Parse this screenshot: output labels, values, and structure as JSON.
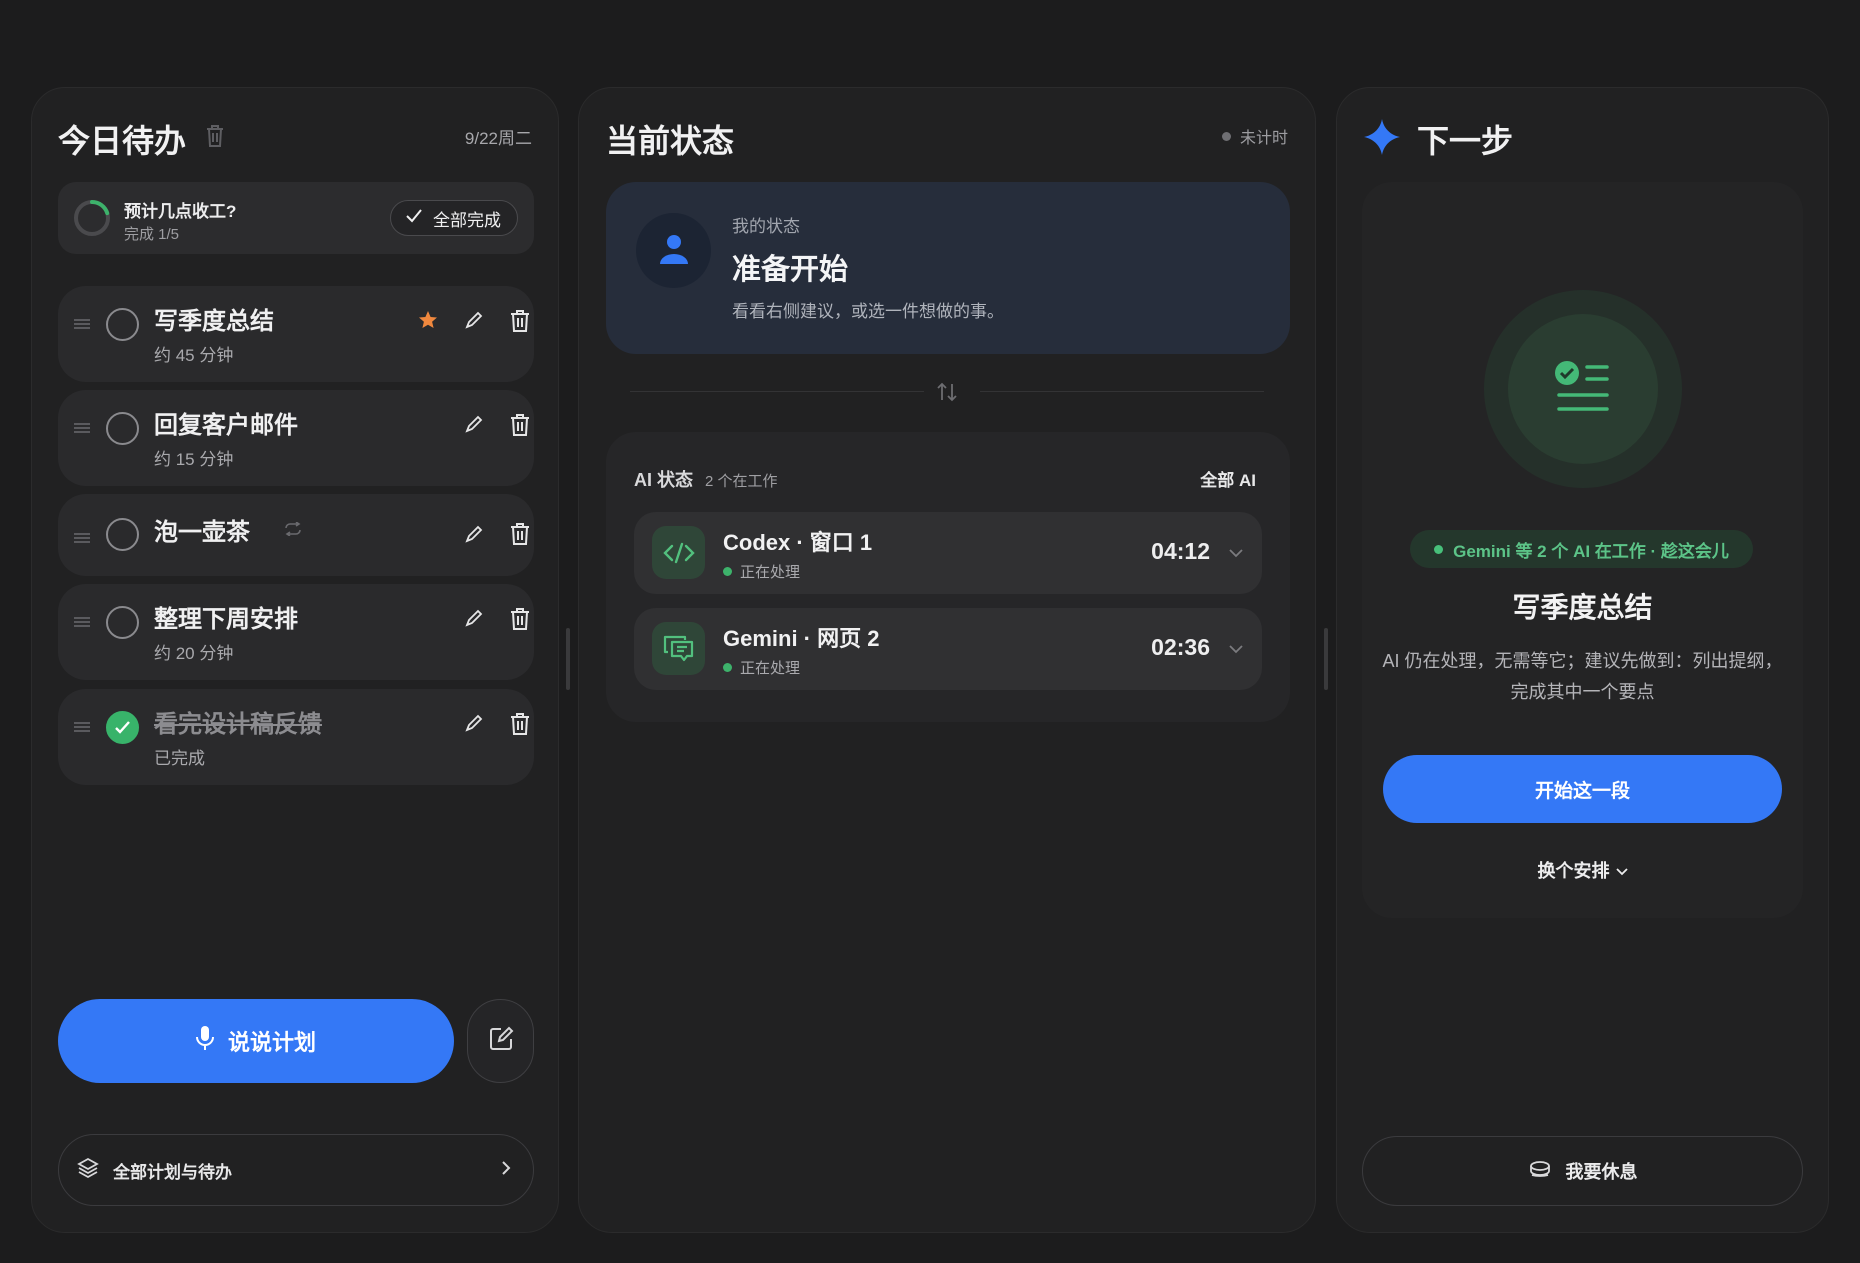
{
  "today": {
    "title": "今日待办",
    "date": "9/22周二",
    "progress": {
      "question": "预计几点收工?",
      "count": "完成 1/5",
      "fraction": 0.2,
      "all_done_label": "全部完成"
    },
    "tasks": [
      {
        "name": "写季度总结",
        "sub": "约 45 分钟",
        "done": false,
        "starred": true
      },
      {
        "name": "回复客户邮件",
        "sub": "约 15 分钟",
        "done": false,
        "starred": false
      },
      {
        "name": "泡一壶茶",
        "sub": "",
        "done": false,
        "starred": false,
        "repeat": true
      },
      {
        "name": "整理下周安排",
        "sub": "约 20 分钟",
        "done": false,
        "starred": false
      },
      {
        "name": "看完设计稿反馈",
        "sub": "已完成",
        "done": true,
        "starred": false
      }
    ],
    "speak_label": "说说计划",
    "all_plans_label": "全部计划与待办"
  },
  "status": {
    "title": "当前状态",
    "timer_state": "未计时",
    "my_state": {
      "label": "我的状态",
      "title": "准备开始",
      "desc": "看看右侧建议，或选一件想做的事。"
    },
    "ai": {
      "heading": "AI 状态",
      "count": "2 个在工作",
      "all_label": "全部 AI",
      "agents": [
        {
          "name": "Codex · 窗口 1",
          "status": "正在处理",
          "time": "04:12",
          "icon": "code-icon"
        },
        {
          "name": "Gemini · 网页 2",
          "status": "正在处理",
          "time": "02:36",
          "icon": "chat-icon"
        }
      ]
    }
  },
  "next": {
    "title": "下一步",
    "pill": "Gemini 等 2 个 AI 在工作 · 趁这会儿",
    "task": "写季度总结",
    "desc": "AI 仍在处理，无需等它；建议先做到：列出提纲，完成其中一个要点",
    "start_label": "开始这一段",
    "swap_label": "换个安排",
    "rest_label": "我要休息"
  },
  "colors": {
    "accent": "#3478f6",
    "success": "#38b36a",
    "star": "#f0883e",
    "background": "#1c1c1d",
    "panel": "#212122"
  }
}
